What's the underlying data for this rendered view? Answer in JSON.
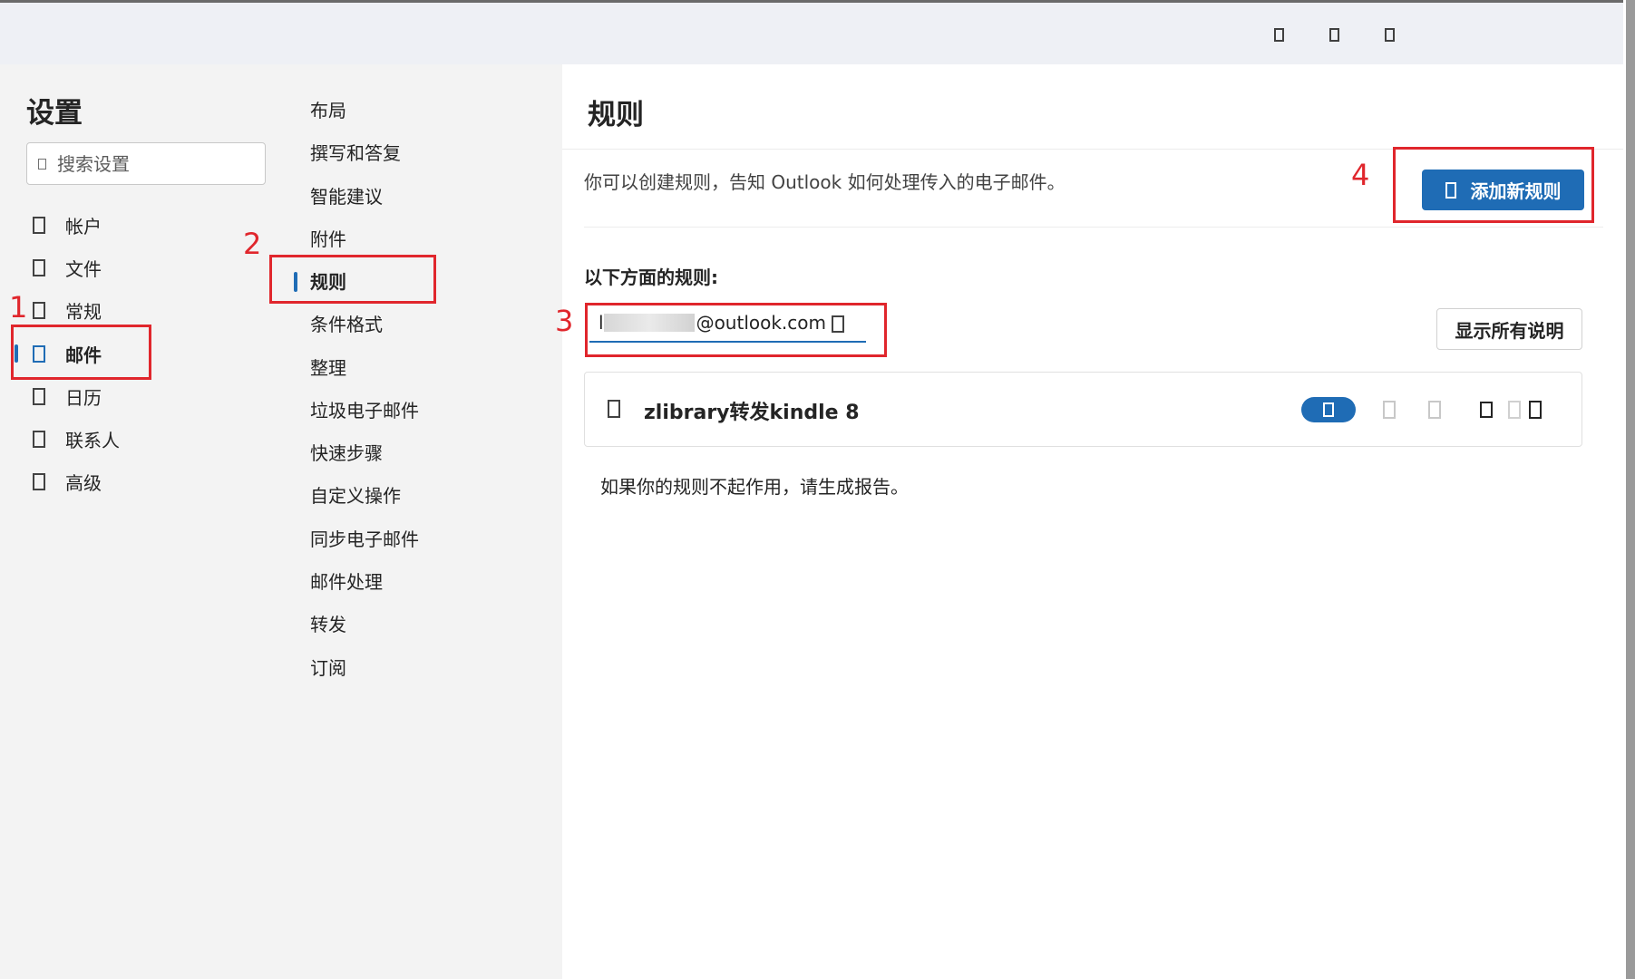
{
  "window": {
    "controls": [
      "minimize-icon",
      "maximize-icon",
      "close-icon"
    ]
  },
  "settings": {
    "title": "设置",
    "search_placeholder": "搜索设置",
    "nav": [
      {
        "label": "帐户",
        "icon": "person-icon",
        "active": false
      },
      {
        "label": "文件",
        "icon": "file-icon",
        "active": false
      },
      {
        "label": "常规",
        "icon": "gear-icon",
        "active": false
      },
      {
        "label": "邮件",
        "icon": "mail-icon",
        "active": true
      },
      {
        "label": "日历",
        "icon": "calendar-icon",
        "active": false
      },
      {
        "label": "联系人",
        "icon": "contacts-icon",
        "active": false
      },
      {
        "label": "高级",
        "icon": "advanced-icon",
        "active": false
      }
    ]
  },
  "mail_menu": {
    "items": [
      {
        "label": "布局",
        "active": false
      },
      {
        "label": "撰写和答复",
        "active": false
      },
      {
        "label": "智能建议",
        "active": false
      },
      {
        "label": "附件",
        "active": false
      },
      {
        "label": "规则",
        "active": true
      },
      {
        "label": "条件格式",
        "active": false
      },
      {
        "label": "整理",
        "active": false
      },
      {
        "label": "垃圾电子邮件",
        "active": false
      },
      {
        "label": "快速步骤",
        "active": false
      },
      {
        "label": "自定义操作",
        "active": false
      },
      {
        "label": "同步电子邮件",
        "active": false
      },
      {
        "label": "邮件处理",
        "active": false
      },
      {
        "label": "转发",
        "active": false
      },
      {
        "label": "订阅",
        "active": false
      }
    ]
  },
  "rules": {
    "title": "规则",
    "description": "你可以创建规则，告知 Outlook 如何处理传入的电子邮件。",
    "add_button": "添加新规则",
    "section_label": "以下方面的规则:",
    "account_prefix": "l",
    "account_suffix": "@outlook.com",
    "show_all_button": "显示所有说明",
    "rule_list": [
      {
        "name": "zlibrary转发kindle 8",
        "enabled": true
      }
    ],
    "hint": "如果你的规则不起作用，请生成报告。"
  },
  "annotations": {
    "labels": [
      "1",
      "2",
      "3",
      "4"
    ],
    "color": "#e0262c"
  },
  "colors": {
    "accent": "#1f6cb5",
    "pane_bg": "#f3f3f3",
    "content_bg": "#ffffff"
  }
}
